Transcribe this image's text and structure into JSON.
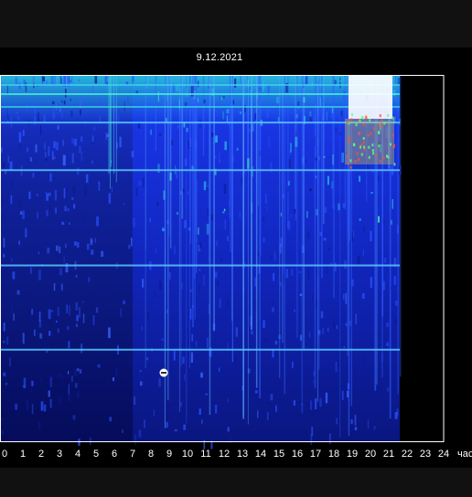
{
  "chart_data": {
    "type": "heatmap",
    "title": "9.12.2021",
    "xlabel": "час",
    "xlim": [
      0,
      24
    ],
    "x_ticks": [
      "0",
      "1",
      "2",
      "3",
      "4",
      "5",
      "6",
      "7",
      "8",
      "9",
      "10",
      "11",
      "12",
      "13",
      "14",
      "15",
      "16",
      "17",
      "18",
      "19",
      "20",
      "21",
      "22",
      "23",
      "24"
    ],
    "data_end_hour": 21.6,
    "gap_before_hour": 7.0,
    "horizontal_lines": [
      {
        "name": "",
        "position": 0.13
      },
      {
        "name": "",
        "position": 0.26
      },
      {
        "name": "",
        "position": 0.52
      },
      {
        "name": "",
        "position": 0.75
      }
    ],
    "hot_spot_hours": [
      19,
      21
    ],
    "marker_hour": 8.7,
    "colors": {
      "low": "#0a0f5c",
      "mid": "#1e3cff",
      "cyan": "#30e0e0",
      "high": "#ffffff",
      "frame": "#ffffff"
    }
  }
}
